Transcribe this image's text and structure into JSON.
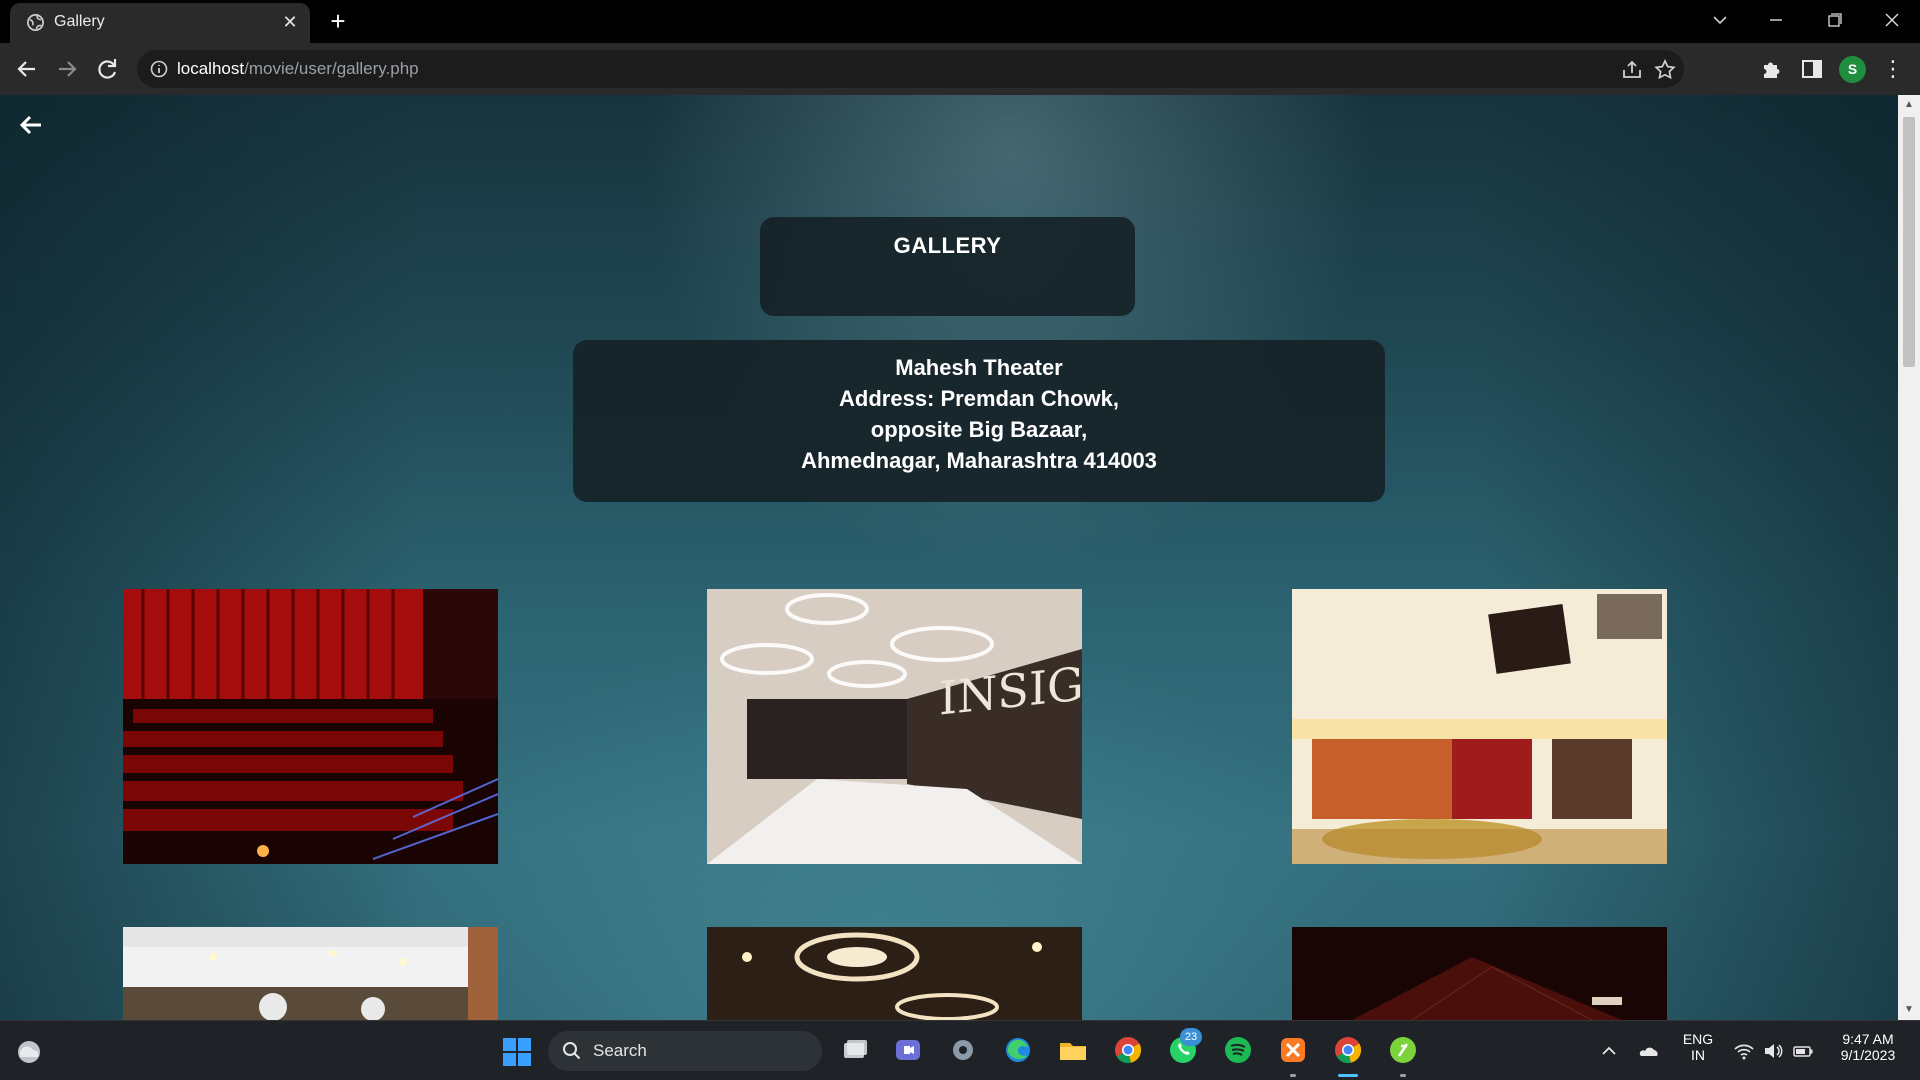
{
  "browser": {
    "tab_title": "Gallery",
    "tab_close": "✕",
    "new_tab": "+",
    "url_host": "localhost",
    "url_path": "/movie/user/gallery.php",
    "profile_initial": "S",
    "menu": "⋮"
  },
  "page": {
    "title": "GALLERY",
    "theater": {
      "name": "Mahesh Theater",
      "address_line1": "Address: Premdan Chowk,",
      "address_line2": "opposite Big Bazaar,",
      "address_line3": "Ahmednagar, Maharashtra 414003"
    },
    "photos": [
      {
        "name": "red-auditorium-seats",
        "colors": [
          "#8b0000",
          "#2a0606"
        ]
      },
      {
        "name": "insignia-lobby",
        "colors": [
          "#d9cfc4",
          "#3b2e28"
        ]
      },
      {
        "name": "foyer-with-posters",
        "colors": [
          "#f2e6c4",
          "#8a3a1a"
        ]
      },
      {
        "name": "interior-ceiling-lights",
        "colors": [
          "#f3f3f3",
          "#6a5a4a"
        ]
      },
      {
        "name": "ornate-ceiling-lobby",
        "colors": [
          "#4b3a2a",
          "#1c140e"
        ]
      },
      {
        "name": "dark-red-hall",
        "colors": [
          "#3a0a0a",
          "#120303"
        ]
      }
    ]
  },
  "taskbar": {
    "search_label": "Search",
    "whatsapp_badge": "23",
    "lang_line1": "ENG",
    "lang_line2": "IN",
    "time": "9:47 AM",
    "date": "9/1/2023"
  },
  "colors": {
    "accent": "#4cc2ff",
    "panel": "#142024",
    "bg_teal": "#2c6371"
  }
}
